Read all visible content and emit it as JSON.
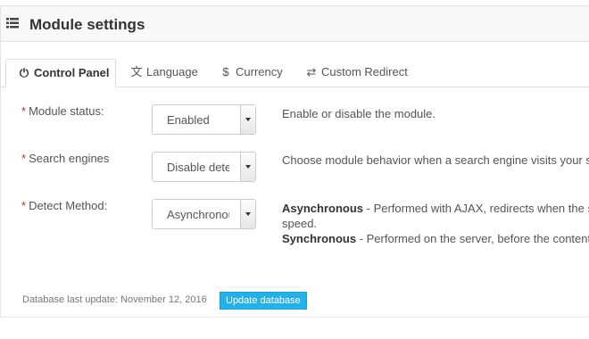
{
  "header": {
    "title": "Module settings",
    "icon": "list-icon"
  },
  "tabs": [
    {
      "label": "Control Panel",
      "icon": "power-icon",
      "glyph": "⏻",
      "active": true
    },
    {
      "label": "Language",
      "icon": "translate-icon",
      "glyph": "文"
    },
    {
      "label": "Currency",
      "icon": "dollar-icon",
      "glyph": "$"
    },
    {
      "label": "Custom Redirect",
      "icon": "exchange-icon",
      "glyph": "⇄"
    }
  ],
  "fields": [
    {
      "label": "Module status:",
      "required": "*",
      "value": "Enabled",
      "help": "Enable or disable the module."
    },
    {
      "label": "Search engines",
      "required": "*",
      "value": "Disable detection",
      "help": "Choose module behavior when a search engine visits your site"
    },
    {
      "label": "Detect Method:",
      "required": "*",
      "value": "Asynchronous",
      "help_async_title": "Asynchronous",
      "help_async_text": " - Performed with AJAX, redirects when the server is done, faster page load speed.",
      "help_async_cont": "speed.",
      "help_sync_title": "Synchronous",
      "help_sync_text": " - Performed on the server, before the content is sent to the browser."
    }
  ],
  "footer": {
    "last_update": "Database last update: November 12, 2016",
    "button_label": "Update database"
  },
  "colors": {
    "accent": "#25b0e8",
    "required": "#c9302c"
  }
}
